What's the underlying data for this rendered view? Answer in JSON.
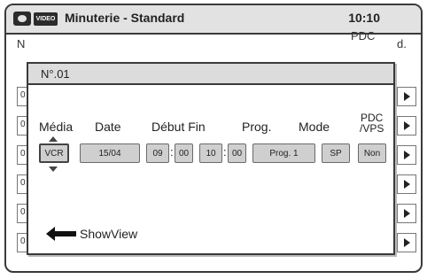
{
  "header": {
    "disc_icon": "disc-icon",
    "video_badge": "VIDEO",
    "title": "Minuterie - Standard",
    "clock": "10:10"
  },
  "list": {
    "col_n": "N",
    "col_pdc": "PDC",
    "col_d": "d.",
    "rows": [
      {
        "num": "0"
      },
      {
        "num": "0"
      },
      {
        "num": "0"
      },
      {
        "num": "0"
      },
      {
        "num": "0"
      },
      {
        "num": "0"
      }
    ]
  },
  "dialog": {
    "heading": "N°.01",
    "labels": {
      "media": "Média",
      "date": "Date",
      "start_end": "Début Fin",
      "prog": "Prog.",
      "mode": "Mode",
      "pdc_line1": "PDC",
      "pdc_line2": "/VPS"
    },
    "fields": {
      "media": "VCR",
      "date": "15/04",
      "start_h": "09",
      "start_m": "00",
      "end_h": "10",
      "end_m": "00",
      "prog": "Prog. 1",
      "mode": "SP",
      "pdc_vps": "Non"
    },
    "colon": ":",
    "showview": "ShowView"
  }
}
